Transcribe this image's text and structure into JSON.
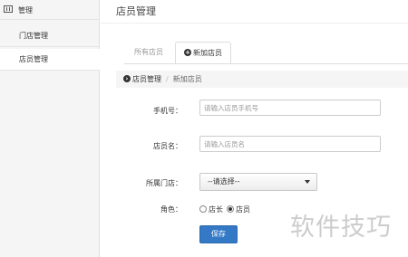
{
  "sidebar": {
    "header_label": "管理",
    "items": [
      {
        "label": "门店管理",
        "active": false
      },
      {
        "label": "店员管理",
        "active": true
      }
    ]
  },
  "page": {
    "title": "店员管理"
  },
  "tabs": [
    {
      "label": "所有店员",
      "active": false
    },
    {
      "label": "新加店员",
      "active": true,
      "icon": "plus-circle-icon"
    }
  ],
  "breadcrumb": {
    "items": [
      "店员管理",
      "新加店员"
    ],
    "separator": "/",
    "icon": "arrow-circle-icon"
  },
  "form": {
    "phone": {
      "label": "手机号：",
      "value": "",
      "placeholder": "请输入店员手机号"
    },
    "name": {
      "label": "店员名：",
      "value": "",
      "placeholder": "请输入店员名"
    },
    "store": {
      "label": "所属门店：",
      "selected": "--请选择--"
    },
    "role": {
      "label": "角色：",
      "options": [
        {
          "label": "店长",
          "checked": false
        },
        {
          "label": "店员",
          "checked": true
        }
      ]
    },
    "save_label": "保存"
  },
  "watermark": "软件技巧",
  "colors": {
    "primary": "#3379c5",
    "sidebar_bg": "#f5f5f5",
    "breadcrumb_bg": "#f5f5f5"
  }
}
